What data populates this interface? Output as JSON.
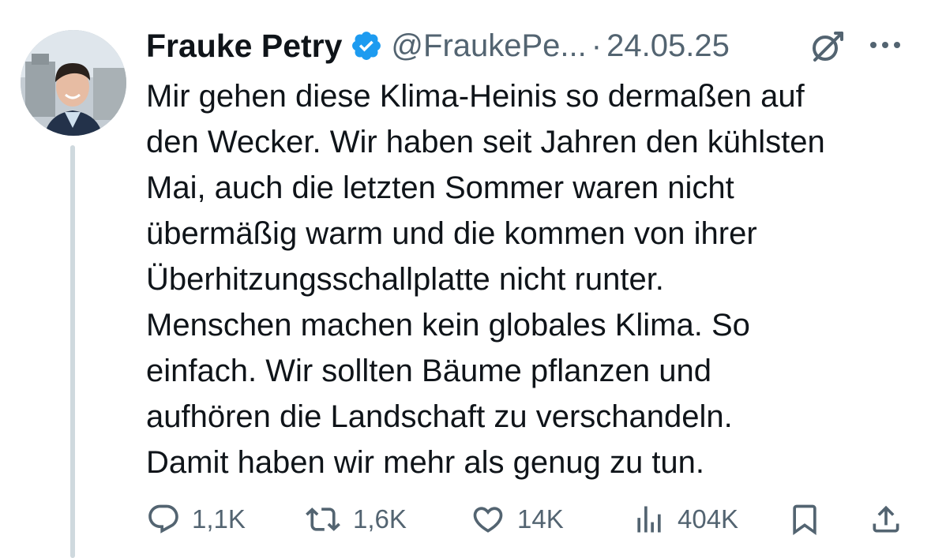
{
  "author": {
    "display_name": "Frauke Petry",
    "handle": "@FraukePe...",
    "separator": "·",
    "date": "24.05.25",
    "verified": true,
    "verified_color": "#1d9bf0"
  },
  "tweet": {
    "lines": [
      "Mir gehen diese Klima-Heinis so dermaßen auf",
      "den Wecker. Wir haben seit Jahren den kühlsten",
      "Mai, auch die letzten Sommer waren nicht",
      "übermäßig warm und die kommen von ihrer",
      "Überhitzungsschallplatte nicht runter.",
      "Menschen machen kein globales Klima. So",
      "einfach. Wir sollten Bäume pflanzen und",
      "aufhören die Landschaft zu verschandeln.",
      "Damit haben wir mehr als genug zu tun."
    ]
  },
  "actions": {
    "replies": "1,1K",
    "retweets": "1,6K",
    "likes": "14K",
    "views": "404K"
  },
  "icons": {
    "grok": "grok-icon",
    "more": "more-icon",
    "reply": "reply-icon",
    "retweet": "retweet-icon",
    "like": "heart-icon",
    "views": "views-icon",
    "bookmark": "bookmark-icon",
    "share": "share-icon"
  },
  "colors": {
    "text": "#0f1419",
    "secondary": "#536471",
    "thread_line": "#cfd9de",
    "accent": "#1d9bf0"
  }
}
